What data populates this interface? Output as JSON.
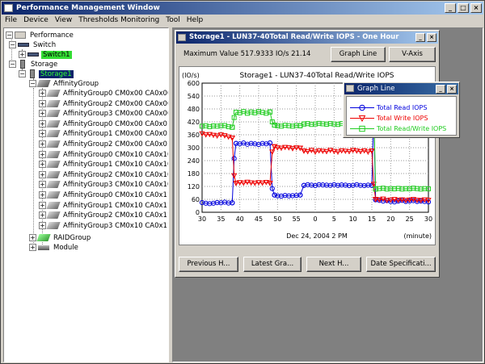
{
  "window": {
    "title": "Performance Management Window"
  },
  "menu": [
    "File",
    "Device",
    "View",
    "Thresholds Monitoring",
    "Tool",
    "Help"
  ],
  "tree": {
    "root": "Performance",
    "switch_group": "Switch",
    "switch_item": "Switch1",
    "storage_group": "Storage",
    "storage_item": "Storage1",
    "affinity_group": "AffinityGroup",
    "affinity_items": [
      "AffinityGroup0 CM0x00 CA0x00",
      "AffinityGroup2 CM0x00 CA0x00",
      "AffinityGroup3 CM0x00 CA0x00",
      "AffinityGroup0 CM0x00 CA0x01",
      "AffinityGroup1 CM0x00 CA0x01",
      "AffinityGroup2 CM0x00 CA0x01",
      "AffinityGroup0 CM0x10 CA0x10",
      "AffinityGroup1 CM0x10 CA0x10",
      "AffinityGroup2 CM0x10 CA0x10",
      "AffinityGroup3 CM0x10 CA0x10",
      "AffinityGroup0 CM0x10 CA0x11",
      "AffinityGroup1 CM0x10 CA0x11",
      "AffinityGroup2 CM0x10 CA0x11",
      "AffinityGroup3 CM0x10 CA0x11"
    ],
    "raid_group": "RAIDGroup",
    "module": "Module"
  },
  "subwindow": {
    "title": "Storage1 - LUN37-40Total Read/Write IOPS - One Hour",
    "max_value": "Maximum Value  517.9333 IO/s  21.14",
    "graph_line_button": "Graph Line",
    "vaxis_button": "V-Axis",
    "buttons": [
      "Previous H...",
      "Latest Gra...",
      "Next H...",
      "Date Specificati..."
    ]
  },
  "legend_window": {
    "title": "Graph Line",
    "entries": [
      "Total Read IOPS",
      "Total Write IOPS",
      "Total Read/Write IOPS"
    ]
  },
  "chart_data": {
    "type": "line",
    "title": "Storage1 - LUN37-40Total Read/Write IOPS",
    "ylabel": "(IO/s)",
    "xlabel": "Dec 24, 2004 2 PM",
    "xunit": "(minute)",
    "ylim": [
      0,
      600
    ],
    "yticks": [
      0,
      60,
      120,
      180,
      240,
      300,
      360,
      420,
      480,
      540,
      600
    ],
    "xtick_labels": [
      "30",
      "35",
      "40",
      "45",
      "50",
      "55",
      "0",
      "5",
      "10",
      "15",
      "20",
      "25",
      "30"
    ],
    "colors": {
      "read": "#0000dd",
      "write": "#ee0000",
      "total": "#22cc22"
    },
    "series": [
      {
        "name": "Total Read IOPS",
        "key": "read",
        "marker": "circle",
        "segments": [
          {
            "x": [
              0,
              1,
              2,
              3,
              4,
              5,
              6,
              7,
              8
            ],
            "y": [
              45,
              42,
              40,
              42,
              45,
              44,
              47,
              43,
              44
            ]
          },
          {
            "x": [
              8,
              8.5,
              9
            ],
            "y": [
              44,
              250,
              320
            ]
          },
          {
            "x": [
              9,
              10,
              11,
              12,
              13,
              14,
              15,
              16,
              17,
              18
            ],
            "y": [
              320,
              318,
              322,
              316,
              320,
              318,
              315,
              320,
              318,
              322
            ]
          },
          {
            "x": [
              18,
              18.6,
              19.2
            ],
            "y": [
              322,
              110,
              80
            ]
          },
          {
            "x": [
              19.2,
              20,
              21,
              22,
              23,
              24,
              25,
              26
            ],
            "y": [
              80,
              76,
              75,
              78,
              76,
              77,
              78,
              80
            ]
          },
          {
            "x": [
              26,
              27
            ],
            "y": [
              80,
              125
            ]
          },
          {
            "x": [
              27,
              28,
              29,
              30,
              31,
              32,
              33,
              34,
              35,
              36,
              37,
              38,
              39,
              40,
              41,
              42,
              43,
              44,
              45
            ],
            "y": [
              125,
              128,
              126,
              124,
              128,
              127,
              126,
              125,
              128,
              125,
              127,
              126,
              124,
              125,
              128,
              125,
              124,
              126,
              125
            ]
          },
          {
            "x": [
              45,
              45.5,
              46
            ],
            "y": [
              125,
              480,
              58
            ]
          },
          {
            "x": [
              46,
              47,
              48,
              49,
              50,
              51,
              52,
              53,
              54,
              55,
              56,
              57,
              58,
              59,
              60
            ],
            "y": [
              58,
              55,
              52,
              54,
              50,
              48,
              52,
              55,
              50,
              52,
              54,
              50,
              52,
              50,
              48
            ]
          }
        ]
      },
      {
        "name": "Total Write IOPS",
        "key": "write",
        "marker": "triangle",
        "segments": [
          {
            "x": [
              0,
              1,
              2,
              3,
              4,
              5,
              6,
              7,
              8
            ],
            "y": [
              365,
              360,
              362,
              358,
              355,
              360,
              356,
              350,
              345
            ]
          },
          {
            "x": [
              8,
              8.5,
              9
            ],
            "y": [
              345,
              170,
              135
            ]
          },
          {
            "x": [
              9,
              10,
              11,
              12,
              13,
              14,
              15,
              16,
              17,
              18
            ],
            "y": [
              135,
              138,
              136,
              140,
              137,
              135,
              138,
              136,
              139,
              135
            ]
          },
          {
            "x": [
              18,
              18.6,
              19.2
            ],
            "y": [
              135,
              280,
              305
            ]
          },
          {
            "x": [
              19.2,
              20,
              21,
              22,
              23,
              24,
              25,
              26
            ],
            "y": [
              305,
              300,
              298,
              302,
              300,
              296,
              300,
              298
            ]
          },
          {
            "x": [
              26,
              27
            ],
            "y": [
              298,
              285
            ]
          },
          {
            "x": [
              27,
              28,
              29,
              30,
              31,
              32,
              33,
              34,
              35,
              36,
              37,
              38,
              39,
              40,
              41,
              42,
              43,
              44,
              45
            ],
            "y": [
              285,
              282,
              288,
              280,
              286,
              284,
              282,
              288,
              283,
              280,
              286,
              284,
              282,
              288,
              285,
              282,
              286,
              280,
              285
            ]
          },
          {
            "x": [
              45,
              45.5,
              46
            ],
            "y": [
              285,
              130,
              60
            ]
          },
          {
            "x": [
              46,
              47,
              48,
              49,
              50,
              51,
              52,
              53,
              54,
              55,
              56,
              57,
              58,
              59,
              60
            ],
            "y": [
              60,
              58,
              62,
              55,
              57,
              60,
              56,
              58,
              55,
              57,
              60,
              56,
              55,
              58,
              56
            ]
          }
        ]
      },
      {
        "name": "Total Read/Write IOPS",
        "key": "total",
        "marker": "square",
        "segments": [
          {
            "x": [
              0,
              1,
              2,
              3,
              4,
              5,
              6,
              7,
              8
            ],
            "y": [
              400,
              402,
              398,
              401,
              400,
              402,
              403,
              398,
              395
            ]
          },
          {
            "x": [
              8,
              8.5,
              9
            ],
            "y": [
              395,
              440,
              465
            ]
          },
          {
            "x": [
              9,
              10,
              11,
              12,
              13,
              14,
              15,
              16,
              17,
              18
            ],
            "y": [
              465,
              462,
              468,
              460,
              466,
              462,
              468,
              464,
              460,
              466
            ]
          },
          {
            "x": [
              18,
              18.6,
              19.2
            ],
            "y": [
              466,
              420,
              405
            ]
          },
          {
            "x": [
              19.2,
              20,
              21,
              22,
              23,
              24,
              25,
              26
            ],
            "y": [
              405,
              402,
              400,
              404,
              402,
              400,
              403,
              402
            ]
          },
          {
            "x": [
              26,
              27
            ],
            "y": [
              402,
              410
            ]
          },
          {
            "x": [
              27,
              28,
              29,
              30,
              31,
              32,
              33,
              34,
              35,
              36,
              37,
              38,
              39,
              40,
              41,
              42,
              43,
              44,
              45
            ],
            "y": [
              410,
              412,
              408,
              410,
              413,
              411,
              409,
              412,
              410,
              408,
              412,
              411,
              409,
              410,
              412,
              410,
              409,
              411,
              410
            ]
          },
          {
            "x": [
              45,
              45.5,
              46
            ],
            "y": [
              410,
              500,
              108
            ]
          },
          {
            "x": [
              46,
              47,
              48,
              49,
              50,
              51,
              52,
              53,
              54,
              55,
              56,
              57,
              58,
              59,
              60
            ],
            "y": [
              108,
              110,
              112,
              108,
              110,
              109,
              111,
              108,
              110,
              109,
              112,
              110,
              108,
              110,
              109
            ]
          }
        ]
      }
    ]
  }
}
